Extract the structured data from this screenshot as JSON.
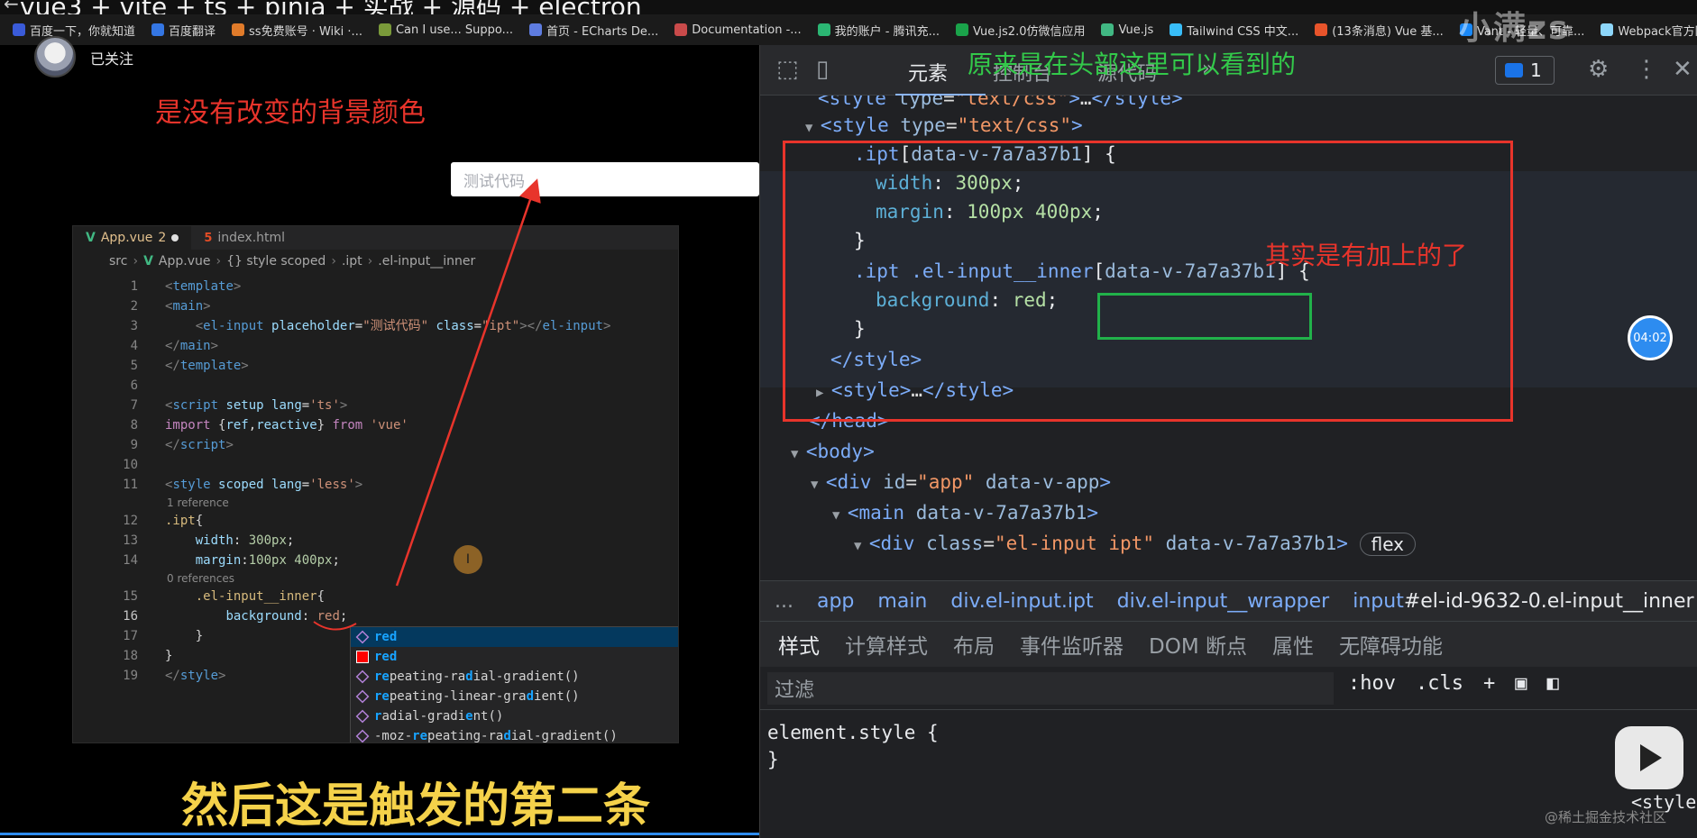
{
  "video": {
    "title": "vue3 + vite + ts + pinia + 实战 + 源码 + electron",
    "watermark": "小满zs",
    "follow_label": "已关注",
    "subtitle": "然后这是触发的第二条",
    "timer": "04:02",
    "corner_mark": "@稀土掘金技术社区"
  },
  "bookmarks": [
    {
      "label": "百度一下，你就知道",
      "color": "#3a5bd9"
    },
    {
      "label": "百度翻译",
      "color": "#3476e3"
    },
    {
      "label": "ss免费账号 · Wiki ·...",
      "color": "#e07b2a"
    },
    {
      "label": "Can I use... Suppo...",
      "color": "#7a9a3a"
    },
    {
      "label": "首页 - ECharts De...",
      "color": "#5e7ce0"
    },
    {
      "label": "Documentation -...",
      "color": "#c94a4a"
    },
    {
      "label": "我的账户 - 腾讯充...",
      "color": "#2bb673"
    },
    {
      "label": "Vue.js2.0仿微信应用",
      "color": "#1aa34a"
    },
    {
      "label": "Vue.js",
      "color": "#41b883"
    },
    {
      "label": "Tailwind CSS 中文...",
      "color": "#38bdf8"
    },
    {
      "label": "(13条消息) Vue 基...",
      "color": "#e8542b"
    },
    {
      "label": "Vant - 轻量、可靠...",
      "color": "#1989fa"
    },
    {
      "label": "Webpack官方网...",
      "color": "#8dd6f9"
    }
  ],
  "annotations": {
    "background_unchanged": "是没有改变的背景颜色",
    "visible_in_head": "原来是在头部这里可以看到的",
    "actually_added": "其实是有加上的了"
  },
  "preview": {
    "input_placeholder": "测试代码"
  },
  "editor": {
    "tabs": [
      {
        "label": "App.vue",
        "badge": "2",
        "active": true
      },
      {
        "label": "index.html",
        "active": false
      }
    ],
    "breadcrumb": [
      "src",
      "App.vue",
      "{} style scoped",
      ".ipt",
      ".el-input__inner"
    ],
    "hints": {
      "one_ref": "1 reference",
      "zero_refs": "0 references"
    },
    "suggestions": [
      {
        "pre": "",
        "hl": "red",
        "post": "",
        "icon": "cube"
      },
      {
        "pre": "",
        "hl": "red",
        "post": "",
        "icon": "color"
      },
      {
        "pre": "",
        "hl": "re",
        "post": "peating-ra",
        "hl2": "d",
        "post2": "ial-gradient()",
        "icon": "cube"
      },
      {
        "pre": "",
        "hl": "re",
        "post": "peating-linear-gra",
        "hl2": "d",
        "post2": "ient()",
        "icon": "cube"
      },
      {
        "pre": "",
        "hl": "r",
        "post": "adial-gradi",
        "hl2": "e",
        "post2": "nt()",
        "icon": "cube"
      },
      {
        "pre": "-moz-",
        "hl": "re",
        "post": "peating-ra",
        "hl2": "d",
        "post2": "ial-gradient()",
        "icon": "cube"
      }
    ]
  },
  "devtools": {
    "tabs": [
      "元素",
      "控制台",
      "源代码",
      "»"
    ],
    "issues_count": "1",
    "breadcrumb": [
      "...",
      "app",
      "main",
      "div.el-input.ipt",
      "div.el-input__wrapper"
    ],
    "breadcrumb_last_tag": "input",
    "breadcrumb_last_rest": "#el-id-9632-0.el-input__inner",
    "style_tabs": [
      "样式",
      "计算样式",
      "布局",
      "事件监听器",
      "DOM 断点",
      "属性",
      "无障碍功能"
    ],
    "filter_placeholder": "过滤",
    "filter_tools": [
      ":hov",
      ".cls",
      "+"
    ],
    "element_style_line1": "element.style {",
    "element_style_line2": "}",
    "style_right": "<style",
    "flex_badge": "flex"
  },
  "colors": {
    "annotation_red": "#e8342b",
    "annotation_green": "#21b14a",
    "subtitle_yellow": "#f5d24a",
    "devtools_bg": "#202124",
    "editor_bg": "#1e1e1e"
  }
}
